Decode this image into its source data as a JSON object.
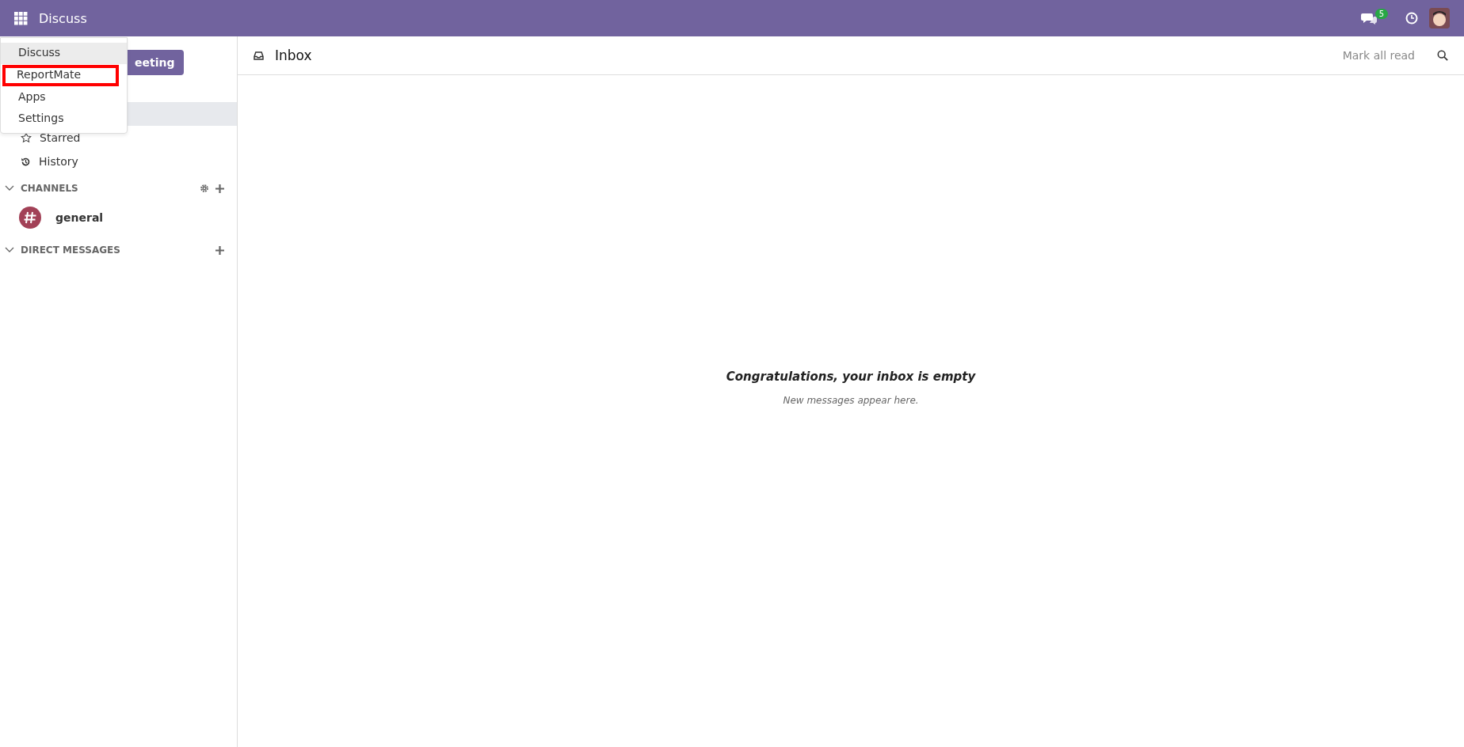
{
  "navbar": {
    "app_name": "Discuss",
    "chat_badge": "5"
  },
  "app_menu": {
    "items": [
      {
        "label": "Discuss",
        "selected": true
      },
      {
        "label": "ReportMate",
        "selected": false,
        "highlighted": true
      },
      {
        "label": "Apps",
        "selected": false
      },
      {
        "label": "Settings",
        "selected": false
      }
    ]
  },
  "sidebar": {
    "meeting_button": "eeting",
    "mailboxes": [
      {
        "kind": "hidden",
        "selected": true
      },
      {
        "kind": "star",
        "label": "Starred",
        "selected": false
      },
      {
        "kind": "history",
        "label": "History",
        "selected": false
      }
    ],
    "channels_header": "CHANNELS",
    "channels": [
      {
        "name": "general",
        "color": "#a24157"
      }
    ],
    "direct_messages_header": "DIRECT MESSAGES"
  },
  "main": {
    "title": "Inbox",
    "mark_all_read": "Mark all read",
    "empty_title": "Congratulations, your inbox is empty",
    "empty_subtitle": "New messages appear here."
  }
}
